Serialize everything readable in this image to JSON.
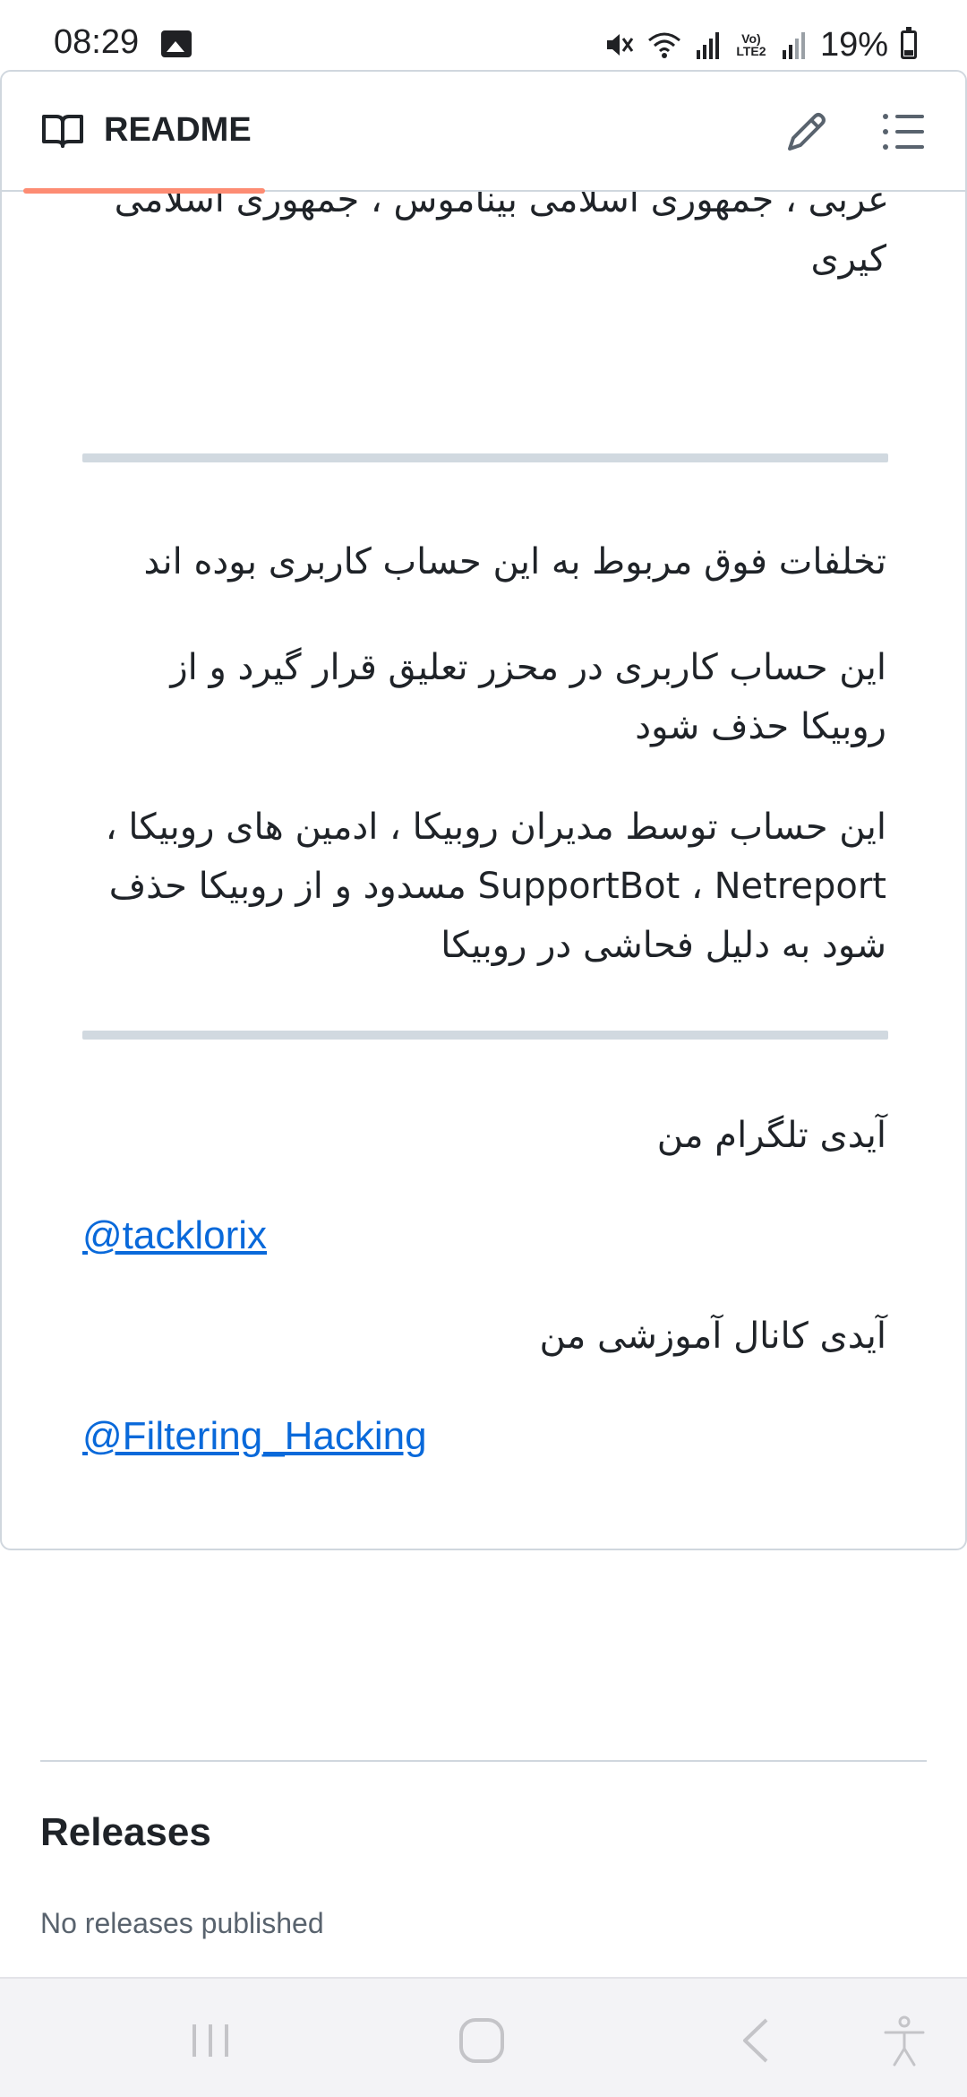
{
  "status_bar": {
    "time": "08:29",
    "volte_label": "Vo) LTE2",
    "battery": "19%",
    "icons": [
      "gallery-icon",
      "mute-icon",
      "wifi-icon",
      "signal-icon",
      "volte-icon",
      "battery-icon"
    ]
  },
  "readme": {
    "title": "README",
    "tab_accent_color": "#fd8c73",
    "edit_icon": "pencil-icon",
    "toc_icon": "list-icon",
    "content": {
      "partial_line_1": "غربی ، جمهوری اسلامی بیناموس ، جمهوری اسلامی",
      "partial_line_2": "کیری",
      "paragraph_1": "تخلفات فوق مربوط به این حساب کاربری بوده اند",
      "paragraph_2": "این حساب کاربری در محزر تعلیق قرار گیرد و از روبیکا حذف شود",
      "paragraph_3": "این حساب توسط مدیران روبیکا ، ادمین های روبیکا ، SupportBot ، Netreport مسدود و از روبیکا حذف شود به دلیل فحاشی در روبیکا",
      "telegram_label": "آیدی تلگرام من",
      "telegram_link": "@tacklorix",
      "channel_label": "آیدی کانال آموزشی من",
      "channel_link": "@Filtering_Hacking",
      "link_color": "#0969da"
    }
  },
  "releases": {
    "heading": "Releases",
    "empty_text": "No releases published"
  },
  "nav_bar": {
    "buttons": [
      "recents-icon",
      "home-icon",
      "back-icon",
      "accessibility-icon"
    ]
  }
}
